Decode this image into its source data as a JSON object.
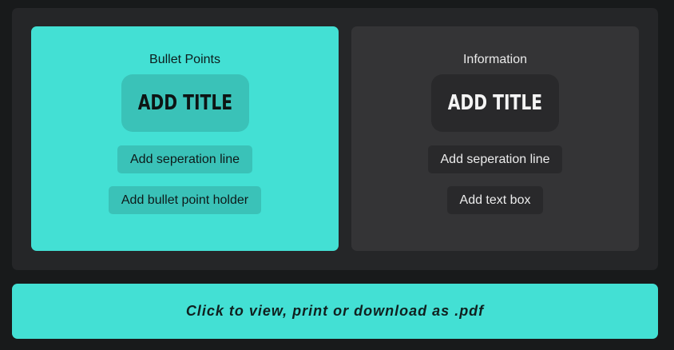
{
  "colors": {
    "page_background": "#181a1b",
    "panel_background": "#252628",
    "accent_teal": "#43e0d4",
    "teal_button": "#3ac2b8",
    "dark_card": "#343436",
    "dark_button": "#29292b"
  },
  "bullet_card": {
    "heading": "Bullet Points",
    "title_button": "ADD TITLE",
    "separation_button": "Add seperation line",
    "second_button": "Add bullet point holder"
  },
  "info_card": {
    "heading": "Information",
    "title_button": "ADD TITLE",
    "separation_button": "Add seperation line",
    "second_button": "Add text box"
  },
  "pdf_bar": {
    "label": "Click to view, print or download as .pdf"
  }
}
